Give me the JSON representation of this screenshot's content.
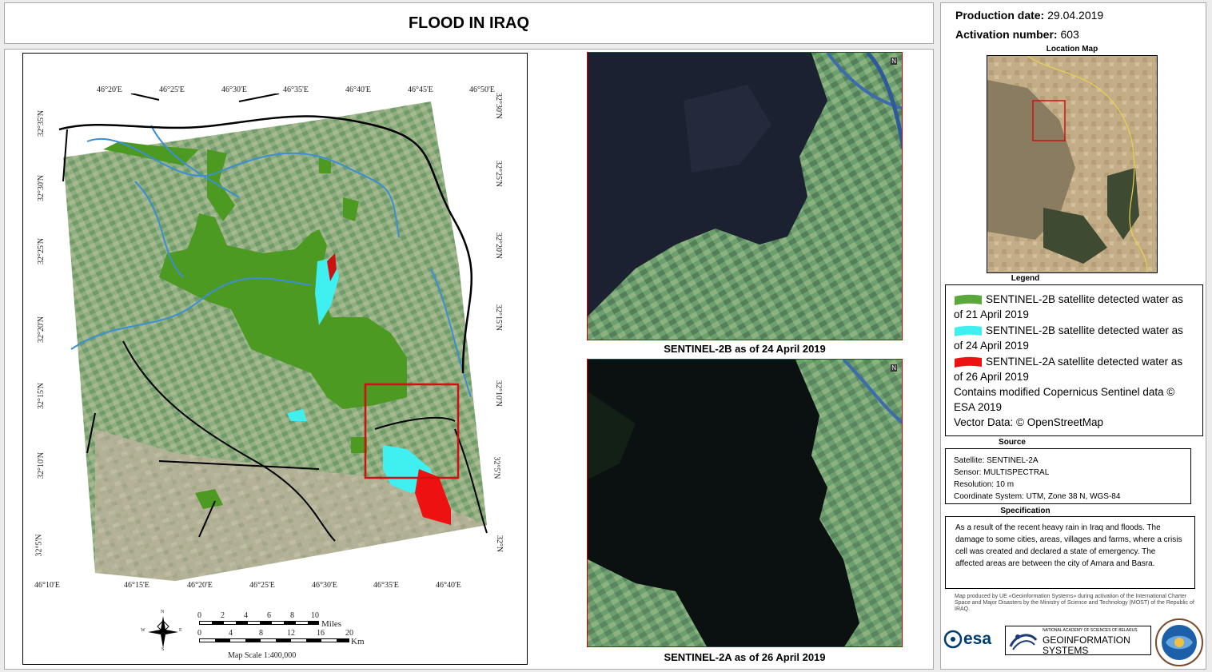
{
  "title": "FLOOD IN IRAQ",
  "map": {
    "top_lon_labels": [
      "46°20'E",
      "46°25'E",
      "46°30'E",
      "46°35'E",
      "46°40'E",
      "46°45'E",
      "46°50'E"
    ],
    "bottom_lon_labels": [
      "46°10'E",
      "46°15'E",
      "46°20'E",
      "46°25'E",
      "46°30'E",
      "46°35'E",
      "46°40'E"
    ],
    "left_lat_labels": [
      "32°35'N",
      "32°30'N",
      "32°25'N",
      "32°20'N",
      "32°15'N",
      "32°10'N",
      "32°5'N"
    ],
    "right_lat_labels": [
      "32°30'N",
      "32°25'N",
      "32°20'N",
      "32°15'N",
      "32°10'N",
      "32°5'N",
      "32°N"
    ],
    "scale_miles_ticks": [
      "0",
      "2",
      "4",
      "6",
      "8",
      "10"
    ],
    "scale_miles_unit": "Miles",
    "scale_km_ticks": [
      "0",
      "4",
      "8",
      "12",
      "16",
      "20"
    ],
    "scale_km_unit": "Km",
    "scale_text": "Map Scale 1:400,000",
    "compass": {
      "n": "N",
      "s": "S",
      "e": "E",
      "w": "W"
    }
  },
  "satellite_captions": {
    "top": "SENTINEL-2B as of 24 April 2019",
    "bottom": "SENTINEL-2A as of 26 April 2019",
    "north_marker": "N"
  },
  "production": {
    "label": "Production date:",
    "value": "29.04.2019"
  },
  "activation": {
    "label": "Activation number:",
    "value": "603"
  },
  "location_map_title": "Location Map",
  "legend": {
    "title": "Legend",
    "items": [
      {
        "text": "SENTINEL-2B satellite detected water as of 21 April 2019",
        "color": "#5aa83c"
      },
      {
        "text": "SENTINEL-2B satellite detected water as of 24 April 2019",
        "color": "#40f0f0"
      },
      {
        "text": "SENTINEL-2A satellite detected water as of 26 April 2019",
        "color": "#ee1111"
      }
    ],
    "copernicus": "Contains modified Copernicus Sentinel data © ESA 2019",
    "vector": "Vector Data: © OpenStreetMap"
  },
  "source": {
    "title": "Source",
    "satellite": "Satellite: SENTINEL-2A",
    "sensor": "Sensor:  MULTISPECTRAL",
    "resolution": "Resolution:  10 m",
    "crs": "Coordinate System: UTM, Zone 38 N, WGS-84"
  },
  "specification": {
    "title": "Specification",
    "text": "As a result of the recent heavy rain in Iraq and floods. The damage to some cities, areas, villages and farms, where a crisis cell was  created and declared a state of emergency.  The affected areas  are between the city of Amara and Basra."
  },
  "credits": {
    "produced_by": "Map produced by UE «Geoinformation Systems» during activation of the International Charter Space and Major Disasters by the Ministry of Science and Technology (MOST) of the Republic of IRAQ."
  },
  "logos": {
    "esa": "esa",
    "academy_line": "NATIONAL ACADEMY OF SCIENCES OF BELARUS",
    "geo_line1": "GEOINFORMATION",
    "geo_line2": "SYSTEMS"
  }
}
